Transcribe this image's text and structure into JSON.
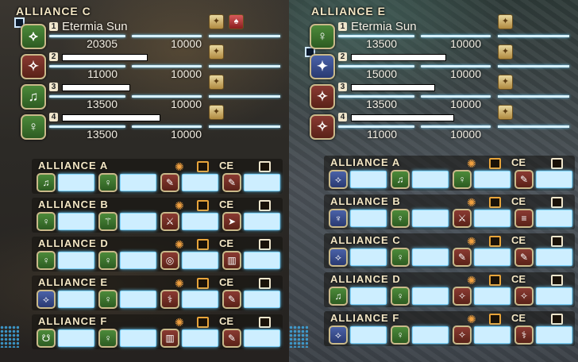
{
  "left": {
    "title": "ALLIANCE C",
    "members": [
      {
        "num": "1",
        "name": "Etermia Sun",
        "hp": "20305",
        "mp": "10000",
        "job": "green",
        "glyph": "⟡"
      },
      {
        "num": "2",
        "name": "",
        "hp": "11000",
        "mp": "10000",
        "job": "red",
        "glyph": "✧"
      },
      {
        "num": "3",
        "name": "",
        "hp": "13500",
        "mp": "10000",
        "job": "green",
        "glyph": "♫"
      },
      {
        "num": "4",
        "name": "",
        "hp": "13500",
        "mp": "10000",
        "job": "green",
        "glyph": "♀"
      }
    ],
    "subs": [
      {
        "title": "ALLIANCE A",
        "ce_label": "CE",
        "slots": [
          {
            "job": "green",
            "glyph": "♫"
          },
          {
            "job": "green",
            "glyph": "♀"
          },
          {
            "job": "red",
            "glyph": "✎"
          },
          {
            "job": "red",
            "glyph": "✎"
          }
        ]
      },
      {
        "title": "ALLIANCE B",
        "ce_label": "CE",
        "slots": [
          {
            "job": "green",
            "glyph": "♀"
          },
          {
            "job": "green",
            "glyph": "⚚"
          },
          {
            "job": "red",
            "glyph": "⚔"
          },
          {
            "job": "red",
            "glyph": "➤"
          }
        ]
      },
      {
        "title": "ALLIANCE D",
        "ce_label": "CE",
        "slots": [
          {
            "job": "green",
            "glyph": "♀"
          },
          {
            "job": "green",
            "glyph": "♀"
          },
          {
            "job": "red",
            "glyph": "◎"
          },
          {
            "job": "red",
            "glyph": "▥"
          }
        ]
      },
      {
        "title": "ALLIANCE E",
        "ce_label": "CE",
        "slots": [
          {
            "job": "blue",
            "glyph": "⟡"
          },
          {
            "job": "green",
            "glyph": "♀"
          },
          {
            "job": "red",
            "glyph": "⚕"
          },
          {
            "job": "red",
            "glyph": "✎"
          }
        ]
      },
      {
        "title": "ALLIANCE F",
        "ce_label": "CE",
        "slots": [
          {
            "job": "green",
            "glyph": "☋"
          },
          {
            "job": "green",
            "glyph": "♀"
          },
          {
            "job": "red",
            "glyph": "▥"
          },
          {
            "job": "red",
            "glyph": "✎"
          }
        ]
      }
    ]
  },
  "right": {
    "title": "ALLIANCE E",
    "members": [
      {
        "num": "1",
        "name": "Etermia Sun",
        "hp": "13500",
        "mp": "10000",
        "job": "green",
        "glyph": "♀"
      },
      {
        "num": "2",
        "name": "",
        "hp": "15000",
        "mp": "10000",
        "job": "blue",
        "glyph": "✦"
      },
      {
        "num": "3",
        "name": "",
        "hp": "13500",
        "mp": "10000",
        "job": "red",
        "glyph": "✧"
      },
      {
        "num": "4",
        "name": "",
        "hp": "11000",
        "mp": "10000",
        "job": "red",
        "glyph": "✧"
      }
    ],
    "subs": [
      {
        "title": "ALLIANCE A",
        "ce_label": "CE",
        "slots": [
          {
            "job": "blue",
            "glyph": "⟡"
          },
          {
            "job": "green",
            "glyph": "♫"
          },
          {
            "job": "green",
            "glyph": "♀"
          },
          {
            "job": "red",
            "glyph": "✎"
          }
        ]
      },
      {
        "title": "ALLIANCE B",
        "ce_label": "CE",
        "slots": [
          {
            "job": "blue",
            "glyph": "♆"
          },
          {
            "job": "green",
            "glyph": "♀"
          },
          {
            "job": "red",
            "glyph": "⚔"
          },
          {
            "job": "red",
            "glyph": "≡"
          }
        ]
      },
      {
        "title": "ALLIANCE C",
        "ce_label": "CE",
        "slots": [
          {
            "job": "blue",
            "glyph": "⟡"
          },
          {
            "job": "green",
            "glyph": "♀"
          },
          {
            "job": "red",
            "glyph": "✎"
          },
          {
            "job": "red",
            "glyph": "✎"
          }
        ]
      },
      {
        "title": "ALLIANCE D",
        "ce_label": "CE",
        "slots": [
          {
            "job": "green",
            "glyph": "♫"
          },
          {
            "job": "green",
            "glyph": "♀"
          },
          {
            "job": "red",
            "glyph": "✧"
          },
          {
            "job": "red",
            "glyph": "✧"
          }
        ]
      },
      {
        "title": "ALLIANCE F",
        "ce_label": "CE",
        "slots": [
          {
            "job": "blue",
            "glyph": "⟡"
          },
          {
            "job": "green",
            "glyph": "♀"
          },
          {
            "job": "red",
            "glyph": "✧"
          },
          {
            "job": "red",
            "glyph": "⚕"
          }
        ]
      }
    ]
  }
}
